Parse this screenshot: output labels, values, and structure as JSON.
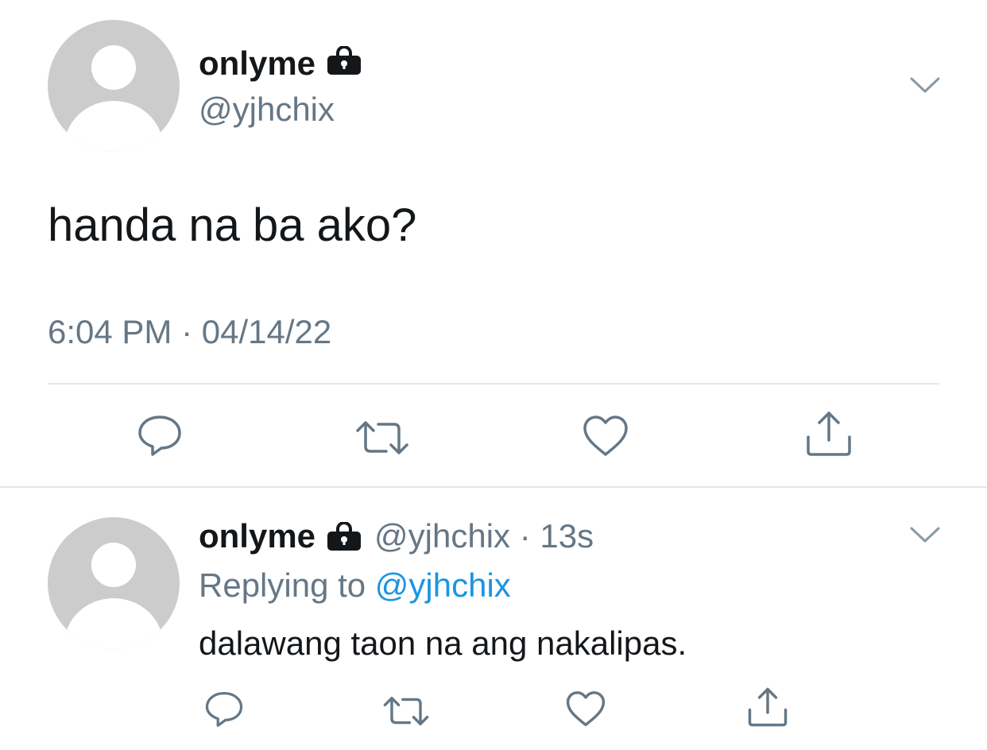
{
  "main_tweet": {
    "display_name": "onlyme",
    "handle": "@yjhchix",
    "text": "handa na ba ako?",
    "timestamp": "6:04 PM · 04/14/22",
    "actions": [
      "reply",
      "retweet",
      "like",
      "share"
    ]
  },
  "reply_tweet": {
    "display_name": "onlyme",
    "handle_time": "@yjhchix · 13s",
    "replying_prefix": "Replying to ",
    "replying_to": "@yjhchix",
    "text": "dalawang taon na ang nakalipas.",
    "actions": [
      "reply",
      "retweet",
      "like",
      "share"
    ]
  },
  "colors": {
    "text": "#14171a",
    "secondary": "#657786",
    "link": "#1b95e0",
    "divider": "#e1e8ed",
    "avatar": "#cccccc"
  },
  "icons": {
    "lock": "lock-icon",
    "chevron": "chevron-down-icon",
    "reply": "reply-icon",
    "retweet": "retweet-icon",
    "like": "heart-icon",
    "share": "share-icon"
  }
}
